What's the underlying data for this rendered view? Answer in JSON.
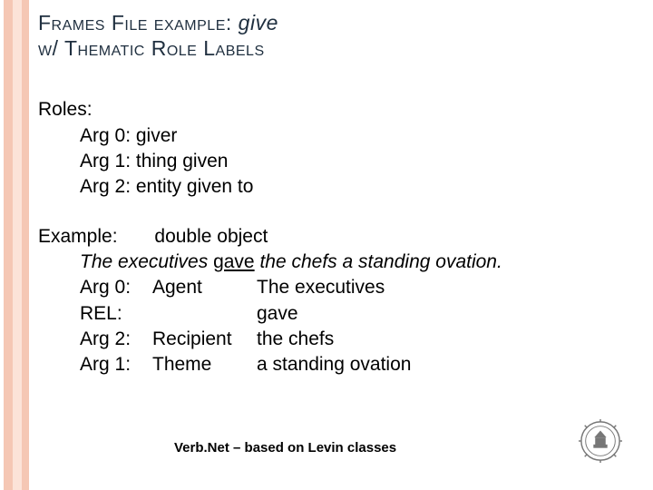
{
  "title": {
    "part1": "Frames File example:",
    "verb": "give",
    "part2": "w/ Thematic Role Labels"
  },
  "roles": {
    "heading": "Roles:",
    "items": [
      "Arg 0: giver",
      "Arg 1: thing given",
      "Arg 2: entity given to"
    ]
  },
  "example": {
    "heading": "Example:",
    "subtype": "double object",
    "sentence_pre": "The executives ",
    "sentence_verb": "gave",
    "sentence_post": " the chefs a standing  ovation.",
    "rows": [
      {
        "arg": "Arg 0:",
        "role": "Agent",
        "span": "The executives"
      },
      {
        "arg": "REL:",
        "role": "",
        "span": "gave"
      },
      {
        "arg": "Arg 2:",
        "role": "Recipient",
        "span": "the chefs"
      },
      {
        "arg": "Arg 1:",
        "role": "Theme",
        "span": "a standing ovation"
      }
    ]
  },
  "footer": "Verb.Net – based on Levin classes"
}
